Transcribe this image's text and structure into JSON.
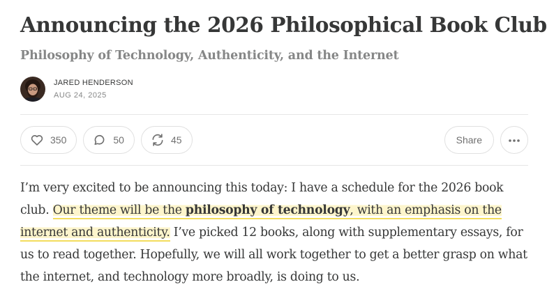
{
  "post": {
    "title": "Announcing the 2026 Philosophical Book Club",
    "subtitle": "Philosophy of Technology, Authenticity, and the Internet",
    "author": "JARED HENDERSON",
    "date": "AUG 24, 2025"
  },
  "actions": {
    "likes": "350",
    "comments": "50",
    "restacks": "45",
    "share_label": "Share"
  },
  "icons": {
    "like": "heart-icon",
    "comment": "speech-bubble-icon",
    "restack": "refresh-arrows-icon",
    "more": "ellipsis-icon"
  },
  "colors": {
    "text": "#363737",
    "muted": "#868787",
    "highlight_fill": "#fdf5cc",
    "highlight_underline": "#f3dd5c",
    "border": "#e0e0e0"
  },
  "body": {
    "intro": "I’m very excited to be announcing this today: I have a schedule for the 2026 book club. ",
    "hl_before": "Our theme will be the ",
    "hl_bold": "philosophy of technology",
    "hl_after": ", with an emphasis on the internet and authenticity.",
    "rest": " I’ve picked 12 books, along with supplementary essays, for us to read together. Hopefully, we will all work together to get a better grasp on what the internet, and technology more broadly, is doing to us."
  }
}
